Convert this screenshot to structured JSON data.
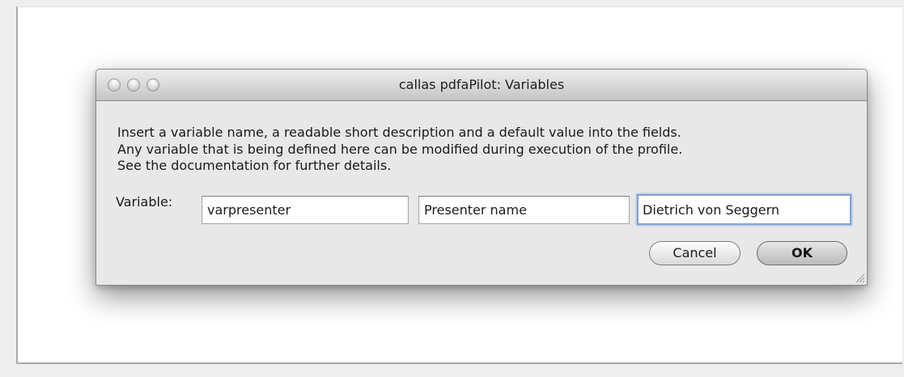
{
  "window": {
    "title": "callas pdfaPilot: Variables"
  },
  "instructions": [
    "Insert a variable name, a readable short description and a default value into the fields.",
    "Any variable that is being defined here can be modified during execution of the profile.",
    "See the documentation for further details."
  ],
  "form": {
    "label": "Variable:",
    "variable_name": "varpresenter",
    "description": "Presenter name",
    "default_value": "Dietrich von Seggern"
  },
  "buttons": {
    "cancel": "Cancel",
    "ok": "OK"
  },
  "icons": {
    "close": "close-window-icon",
    "minimize": "minimize-window-icon",
    "zoom": "zoom-window-icon",
    "resize": "resize-grip-icon"
  }
}
